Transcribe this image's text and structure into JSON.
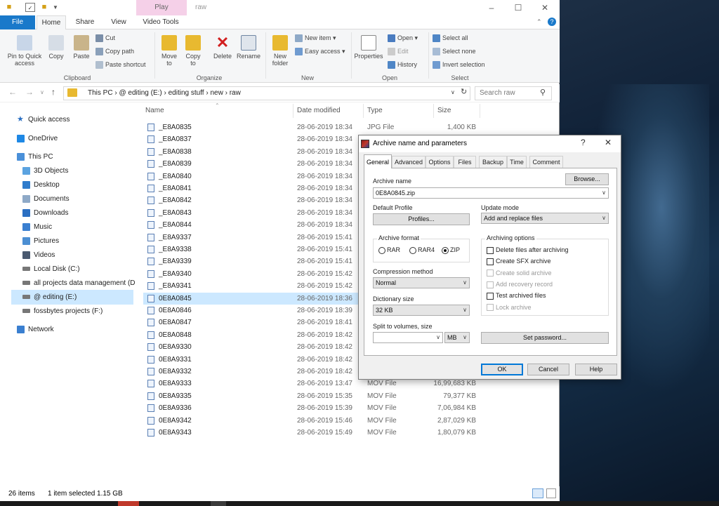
{
  "window": {
    "title_context": "Play",
    "title": "raw",
    "minimize": "–",
    "maximize": "☐",
    "close": "✕"
  },
  "tabs": {
    "file": "File",
    "home": "Home",
    "share": "Share",
    "view": "View",
    "video_tools": "Video Tools"
  },
  "ribbon": {
    "clipboard": {
      "pin": "Pin to Quick access",
      "copy": "Copy",
      "paste": "Paste",
      "cut": "Cut",
      "copy_path": "Copy path",
      "paste_shortcut": "Paste shortcut",
      "label": "Clipboard"
    },
    "organize": {
      "move_to": "Move to",
      "copy_to": "Copy to",
      "delete": "Delete",
      "rename": "Rename",
      "label": "Organize"
    },
    "new": {
      "new_folder": "New folder",
      "new_item": "New item",
      "easy_access": "Easy access",
      "label": "New"
    },
    "open": {
      "properties": "Properties",
      "open": "Open",
      "edit": "Edit",
      "history": "History",
      "label": "Open"
    },
    "select": {
      "select_all": "Select all",
      "select_none": "Select none",
      "invert": "Invert selection",
      "label": "Select"
    }
  },
  "address": {
    "path": "This PC  ›  @ editing  (E:)  ›  editing stuff  ›  new  ›  raw",
    "search_placeholder": "Search raw"
  },
  "nav": [
    {
      "label": "Quick access",
      "icon": "star-icon",
      "color": "#2b6fc2"
    },
    {
      "label": "OneDrive",
      "icon": "cloud-icon",
      "color": "#1e88e5"
    },
    {
      "label": "This PC",
      "icon": "computer-icon",
      "color": "#4a90d9"
    },
    {
      "label": "3D Objects",
      "icon": "cube-icon",
      "color": "#5ba3e0"
    },
    {
      "label": "Desktop",
      "icon": "desktop-icon",
      "color": "#2f7ccc"
    },
    {
      "label": "Documents",
      "icon": "document-icon",
      "color": "#8ea9c7"
    },
    {
      "label": "Downloads",
      "icon": "download-icon",
      "color": "#2b6fc2"
    },
    {
      "label": "Music",
      "icon": "music-icon",
      "color": "#3a7fd0"
    },
    {
      "label": "Pictures",
      "icon": "picture-icon",
      "color": "#4c8fd3"
    },
    {
      "label": "Videos",
      "icon": "video-icon",
      "color": "#4a5a70"
    },
    {
      "label": "Local Disk (C:)",
      "icon": "drive-icon",
      "color": "#666"
    },
    {
      "label": "all projects data management (D",
      "icon": "drive-icon",
      "color": "#666"
    },
    {
      "label": "@ editing  (E:)",
      "icon": "drive-icon",
      "color": "#666"
    },
    {
      "label": "fossbytes projects  (F:)",
      "icon": "drive-icon",
      "color": "#666"
    },
    {
      "label": "Network",
      "icon": "network-icon",
      "color": "#3a7fd0"
    }
  ],
  "columns": {
    "name": "Name",
    "date": "Date modified",
    "type": "Type",
    "size": "Size"
  },
  "files": [
    {
      "name": "_E8A0835",
      "date": "28-06-2019 18:34",
      "type": "JPG File",
      "size": "1,400 KB"
    },
    {
      "name": "_E8A0837",
      "date": "28-06-2019 18:34",
      "type": "",
      "size": ""
    },
    {
      "name": "_E8A0838",
      "date": "28-06-2019 18:34",
      "type": "",
      "size": ""
    },
    {
      "name": "_E8A0839",
      "date": "28-06-2019 18:34",
      "type": "",
      "size": ""
    },
    {
      "name": "_E8A0840",
      "date": "28-06-2019 18:34",
      "type": "",
      "size": ""
    },
    {
      "name": "_E8A0841",
      "date": "28-06-2019 18:34",
      "type": "",
      "size": ""
    },
    {
      "name": "_E8A0842",
      "date": "28-06-2019 18:34",
      "type": "",
      "size": ""
    },
    {
      "name": "_E8A0843",
      "date": "28-06-2019 18:34",
      "type": "",
      "size": ""
    },
    {
      "name": "_E8A0844",
      "date": "28-06-2019 18:34",
      "type": "",
      "size": ""
    },
    {
      "name": "_E8A9337",
      "date": "28-06-2019 15:41",
      "type": "",
      "size": ""
    },
    {
      "name": "_E8A9338",
      "date": "28-06-2019 15:41",
      "type": "",
      "size": ""
    },
    {
      "name": "_E8A9339",
      "date": "28-06-2019 15:41",
      "type": "",
      "size": ""
    },
    {
      "name": "_E8A9340",
      "date": "28-06-2019 15:42",
      "type": "",
      "size": ""
    },
    {
      "name": "_E8A9341",
      "date": "28-06-2019 15:42",
      "type": "",
      "size": ""
    },
    {
      "name": "0E8A0845",
      "date": "28-06-2019 18:36",
      "type": "",
      "size": "",
      "selected": true
    },
    {
      "name": "0E8A0846",
      "date": "28-06-2019 18:39",
      "type": "",
      "size": ""
    },
    {
      "name": "0E8A0847",
      "date": "28-06-2019 18:41",
      "type": "",
      "size": ""
    },
    {
      "name": "0E8A0848",
      "date": "28-06-2019 18:42",
      "type": "",
      "size": ""
    },
    {
      "name": "0E8A9330",
      "date": "28-06-2019 18:42",
      "type": "",
      "size": ""
    },
    {
      "name": "0E8A9331",
      "date": "28-06-2019 18:42",
      "type": "",
      "size": ""
    },
    {
      "name": "0E8A9332",
      "date": "28-06-2019 18:42",
      "type": "",
      "size": ""
    },
    {
      "name": "0E8A9333",
      "date": "28-06-2019 13:47",
      "type": "MOV File",
      "size": "16,99,683 KB"
    },
    {
      "name": "0E8A9335",
      "date": "28-06-2019 15:35",
      "type": "MOV File",
      "size": "79,377 KB"
    },
    {
      "name": "0E8A9336",
      "date": "28-06-2019 15:39",
      "type": "MOV File",
      "size": "7,06,984 KB"
    },
    {
      "name": "0E8A9342",
      "date": "28-06-2019 15:46",
      "type": "MOV File",
      "size": "2,87,029 KB"
    },
    {
      "name": "0E8A9343",
      "date": "28-06-2019 15:49",
      "type": "MOV File",
      "size": "1,80,079 KB"
    }
  ],
  "status": {
    "count": "26 items",
    "selected": "1 item selected  1.15 GB"
  },
  "dialog": {
    "title": "Archive name and parameters",
    "help": "?",
    "close": "✕",
    "tabs": [
      "General",
      "Advanced",
      "Options",
      "Files",
      "Backup",
      "Time",
      "Comment"
    ],
    "archive_name_label": "Archive name",
    "browse": "Browse...",
    "archive_name": "0E8A0845.zip",
    "default_profile_label": "Default Profile",
    "profiles": "Profiles...",
    "update_mode_label": "Update mode",
    "update_mode": "Add and replace files",
    "archive_format_label": "Archive format",
    "formats": [
      "RAR",
      "RAR4",
      "ZIP"
    ],
    "selected_format": "ZIP",
    "archiving_options_label": "Archiving options",
    "options": [
      {
        "label": "Delete files after archiving",
        "disabled": false
      },
      {
        "label": "Create SFX archive",
        "disabled": false
      },
      {
        "label": "Create solid archive",
        "disabled": true
      },
      {
        "label": "Add recovery record",
        "disabled": true
      },
      {
        "label": "Test archived files",
        "disabled": false
      },
      {
        "label": "Lock archive",
        "disabled": true
      }
    ],
    "compression_label": "Compression method",
    "compression": "Normal",
    "dictionary_label": "Dictionary size",
    "dictionary": "32 KB",
    "split_label": "Split to volumes, size",
    "split_value": "",
    "split_unit": "MB",
    "set_password": "Set password...",
    "ok": "OK",
    "cancel": "Cancel",
    "help_btn": "Help"
  }
}
